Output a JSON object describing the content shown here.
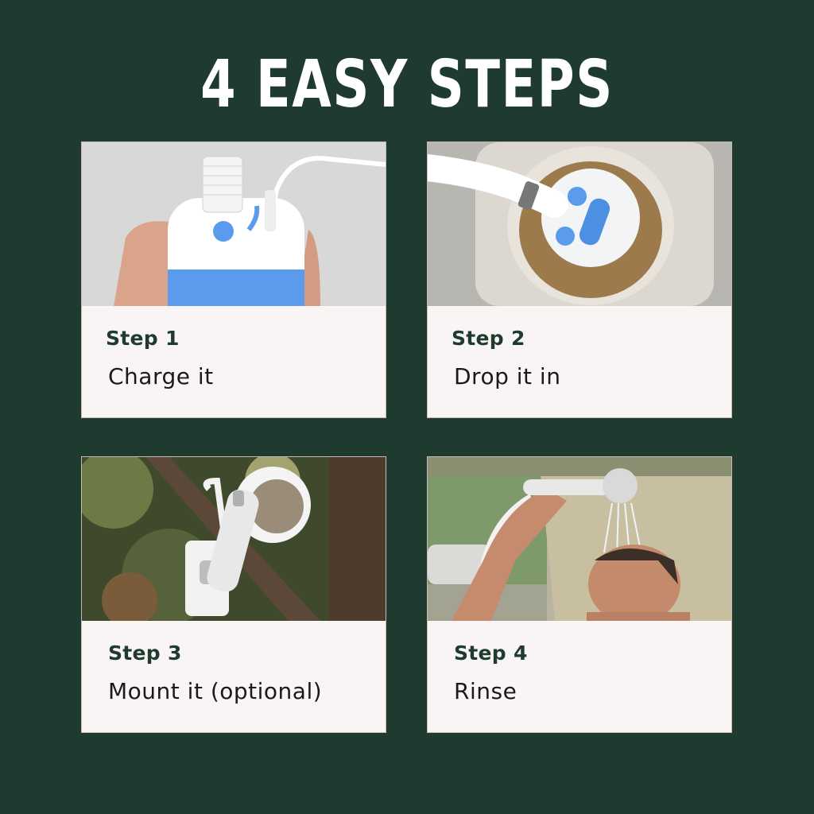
{
  "headline": "4 EASY STEPS",
  "colors": {
    "background": "#1f3a2e",
    "card": "#f8f5f4",
    "label": "#1f3a2e",
    "accent": "#5b9bec"
  },
  "steps": [
    {
      "label": "Step 1",
      "text": "Charge it",
      "photo": "hand holding blue and white pump being charged"
    },
    {
      "label": "Step 2",
      "text": "Drop it in",
      "photo": "pump dropped into water container"
    },
    {
      "label": "Step 3",
      "text": "Mount it (optional)",
      "photo": "shower head hooked on tree branch"
    },
    {
      "label": "Step 4",
      "text": "Rinse",
      "photo": "man rinsing under shower head at campsite"
    }
  ]
}
